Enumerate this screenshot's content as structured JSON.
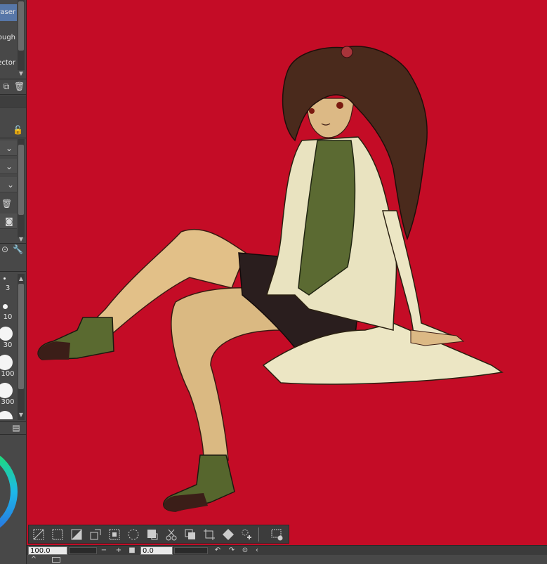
{
  "tool_list": {
    "items": [
      {
        "label": "Eraser",
        "selected": true
      },
      {
        "label": "Rough",
        "selected": false
      },
      {
        "label": "Vector",
        "selected": false
      }
    ]
  },
  "brush_sizes": [
    "3",
    "10",
    "30",
    "100",
    "300"
  ],
  "status": {
    "zoom_value": "100.0",
    "rotation_value": "0.0"
  },
  "colors": {
    "canvas_bg": "#c40c26",
    "panel_bg": "#484848",
    "selected_tool": "#5777a8"
  },
  "toolbar_icons": [
    "clear-selection-icon",
    "invert-selection-icon",
    "fill-selection-icon",
    "scale-selection-icon",
    "crop-selection-icon",
    "select-dotted-icon",
    "shrink-selection-icon",
    "cut-icon",
    "copy-layer-icon",
    "transform-icon",
    "fill-bucket-icon",
    "select-more-icon",
    "selection-settings-icon"
  ]
}
